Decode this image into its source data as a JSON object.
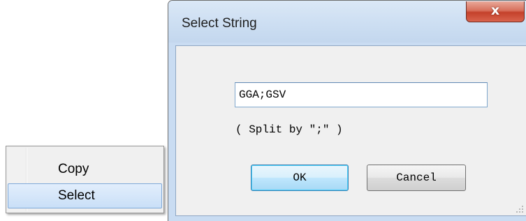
{
  "context_menu": {
    "items": [
      {
        "label": "Copy"
      },
      {
        "label": "Select"
      }
    ]
  },
  "dialog": {
    "title": "Select String",
    "close_symbol": "x",
    "input_value": "GGA;GSV",
    "hint": "( Split by \";\" )",
    "ok_label": "OK",
    "cancel_label": "Cancel"
  },
  "colors": {
    "menu_highlight": "#c9dff7",
    "window_frame": "#c9dcf2",
    "close_button": "#c4412b",
    "default_button_border": "#3c7fb1"
  },
  "icons": {
    "close": "close-icon",
    "resize": "resize-grip-icon"
  }
}
